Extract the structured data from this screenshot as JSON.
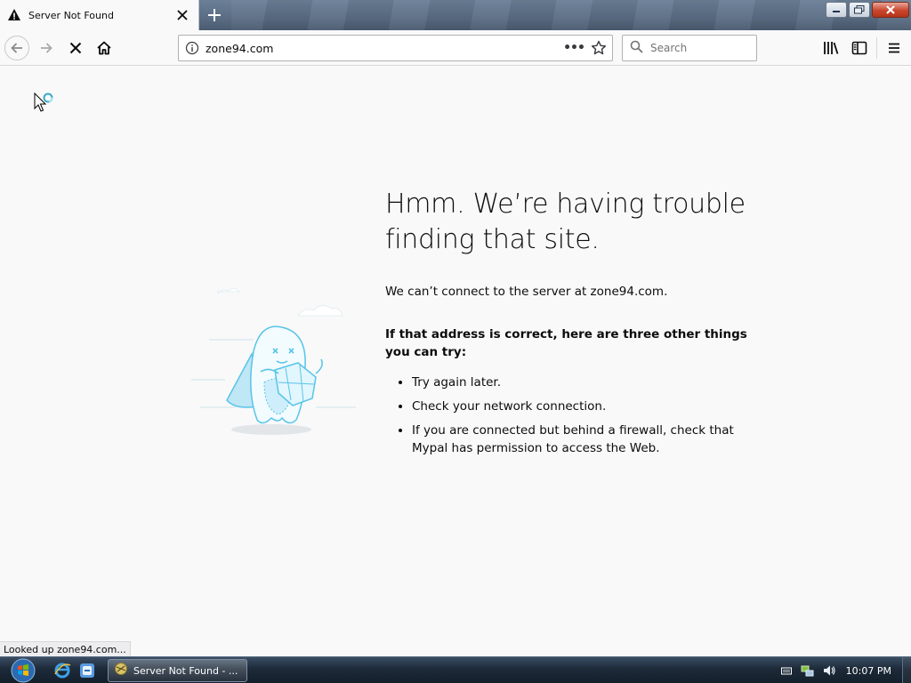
{
  "tab": {
    "title": "Server Not Found",
    "icon": "warning-icon"
  },
  "navbar": {
    "url": "zone94.com",
    "search_placeholder": "Search",
    "page_actions": "•••"
  },
  "error": {
    "heading": "Hmm. We’re having trouble finding that site.",
    "description": "We can’t connect to the server at zone94.com.",
    "tries_heading": "If that address is correct, here are three other things you can try:",
    "tries": [
      "Try again later.",
      "Check your network connection.",
      "If you are connected but behind a firewall, check that Mypal has permission to access the Web."
    ]
  },
  "status": {
    "text": "Looked up zone94.com..."
  },
  "taskbar": {
    "task_label": "Server Not Found - ...",
    "clock": "10:07 PM"
  },
  "colors": {
    "accent": "#0a84ff",
    "illustration": "#58c4e8",
    "taskbar": "#1d2a39"
  }
}
